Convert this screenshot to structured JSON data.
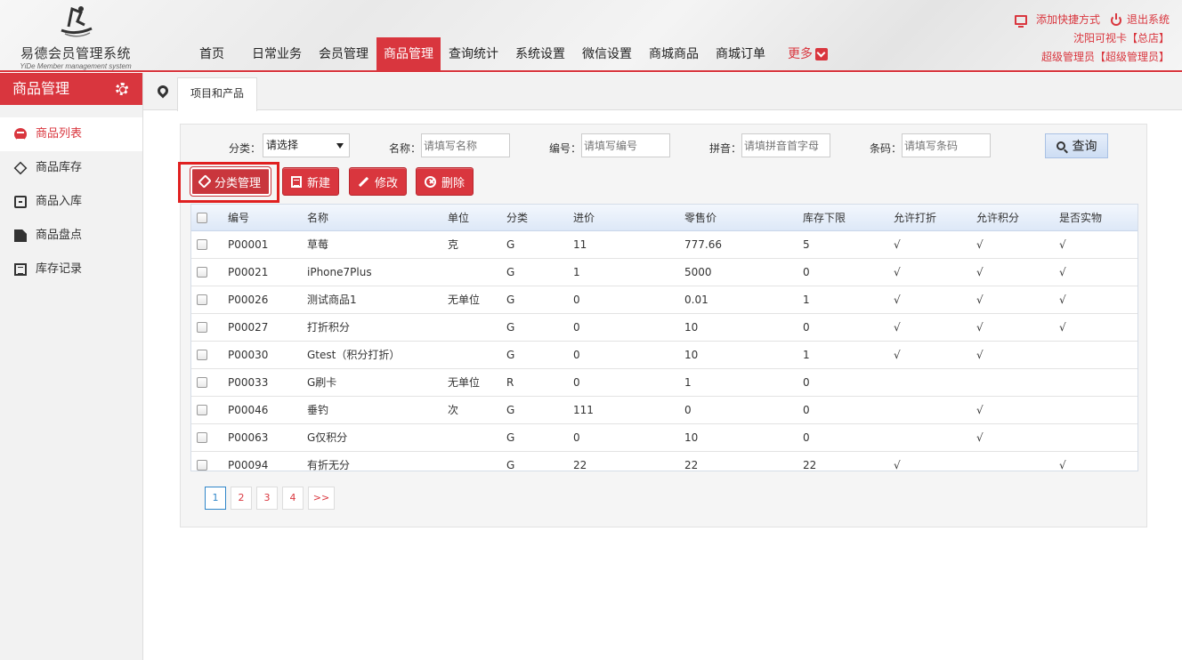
{
  "app": {
    "title": "易德会员管理系统",
    "subtitle": "YiDe Member management system"
  },
  "nav": {
    "items": [
      "首页",
      "日常业务",
      "会员管理",
      "商品管理",
      "查询统计",
      "系统设置",
      "微信设置",
      "商城商品",
      "商城订单"
    ],
    "active": "商品管理",
    "more": "更多"
  },
  "topright": {
    "shortcut": "添加快捷方式",
    "logout": "退出系统",
    "store": "沈阳可视卡【总店】",
    "user": "超级管理员【超级管理员】"
  },
  "sidebar": {
    "title": "商品管理",
    "items": [
      {
        "label": "商品列表",
        "icon": "list-icon",
        "active": true
      },
      {
        "label": "商品库存",
        "icon": "dropbox-icon",
        "active": false
      },
      {
        "label": "商品入库",
        "icon": "inbox-icon",
        "active": false
      },
      {
        "label": "商品盘点",
        "icon": "document-icon",
        "active": false
      },
      {
        "label": "库存记录",
        "icon": "book-icon",
        "active": false
      }
    ]
  },
  "tab": {
    "label": "项目和产品"
  },
  "filters": {
    "category_label": "分类：",
    "category_value": "请选择",
    "name_label": "名称：",
    "name_placeholder": "请填写名称",
    "code_label": "编号：",
    "code_placeholder": "请填写编号",
    "pinyin_label": "拼音：",
    "pinyin_placeholder": "请填拼音首字母",
    "barcode_label": "条码：",
    "barcode_placeholder": "请填写条码",
    "query_label": "查询"
  },
  "actions": {
    "category_manage": "分类管理",
    "new": "新建",
    "edit": "修改",
    "delete": "删除"
  },
  "table": {
    "headers": [
      "编号",
      "名称",
      "单位",
      "分类",
      "进价",
      "零售价",
      "库存下限",
      "允许打折",
      "允许积分",
      "是否实物"
    ],
    "rows": [
      [
        "P00001",
        "草莓",
        "克",
        "G",
        "11",
        "777.66",
        "5",
        "√",
        "√",
        "√"
      ],
      [
        "P00021",
        "iPhone7Plus",
        "",
        "G",
        "1",
        "5000",
        "0",
        "√",
        "√",
        "√"
      ],
      [
        "P00026",
        "测试商品1",
        "无单位",
        "G",
        "0",
        "0.01",
        "1",
        "√",
        "√",
        "√"
      ],
      [
        "P00027",
        "打折积分",
        "",
        "G",
        "0",
        "10",
        "0",
        "√",
        "√",
        "√"
      ],
      [
        "P00030",
        "Gtest（积分打折）",
        "",
        "G",
        "0",
        "10",
        "1",
        "√",
        "√",
        ""
      ],
      [
        "P00033",
        "G刷卡",
        "无单位",
        "R",
        "0",
        "1",
        "0",
        "",
        "",
        ""
      ],
      [
        "P00046",
        "垂钓",
        "次",
        "G",
        "111",
        "0",
        "0",
        "",
        "√",
        ""
      ],
      [
        "P00063",
        "G仅积分",
        "",
        "G",
        "0",
        "10",
        "0",
        "",
        "√",
        ""
      ],
      [
        "P00094",
        "有折无分",
        "",
        "G",
        "22",
        "22",
        "22",
        "√",
        "",
        "√"
      ]
    ]
  },
  "pagination": {
    "pages": [
      "1",
      "2",
      "3",
      "4"
    ],
    "current": "1",
    "next": ">>"
  },
  "colors": {
    "accent": "#d9363e",
    "query_button": "#cdddf3",
    "pager_active": "#2f86c9"
  }
}
